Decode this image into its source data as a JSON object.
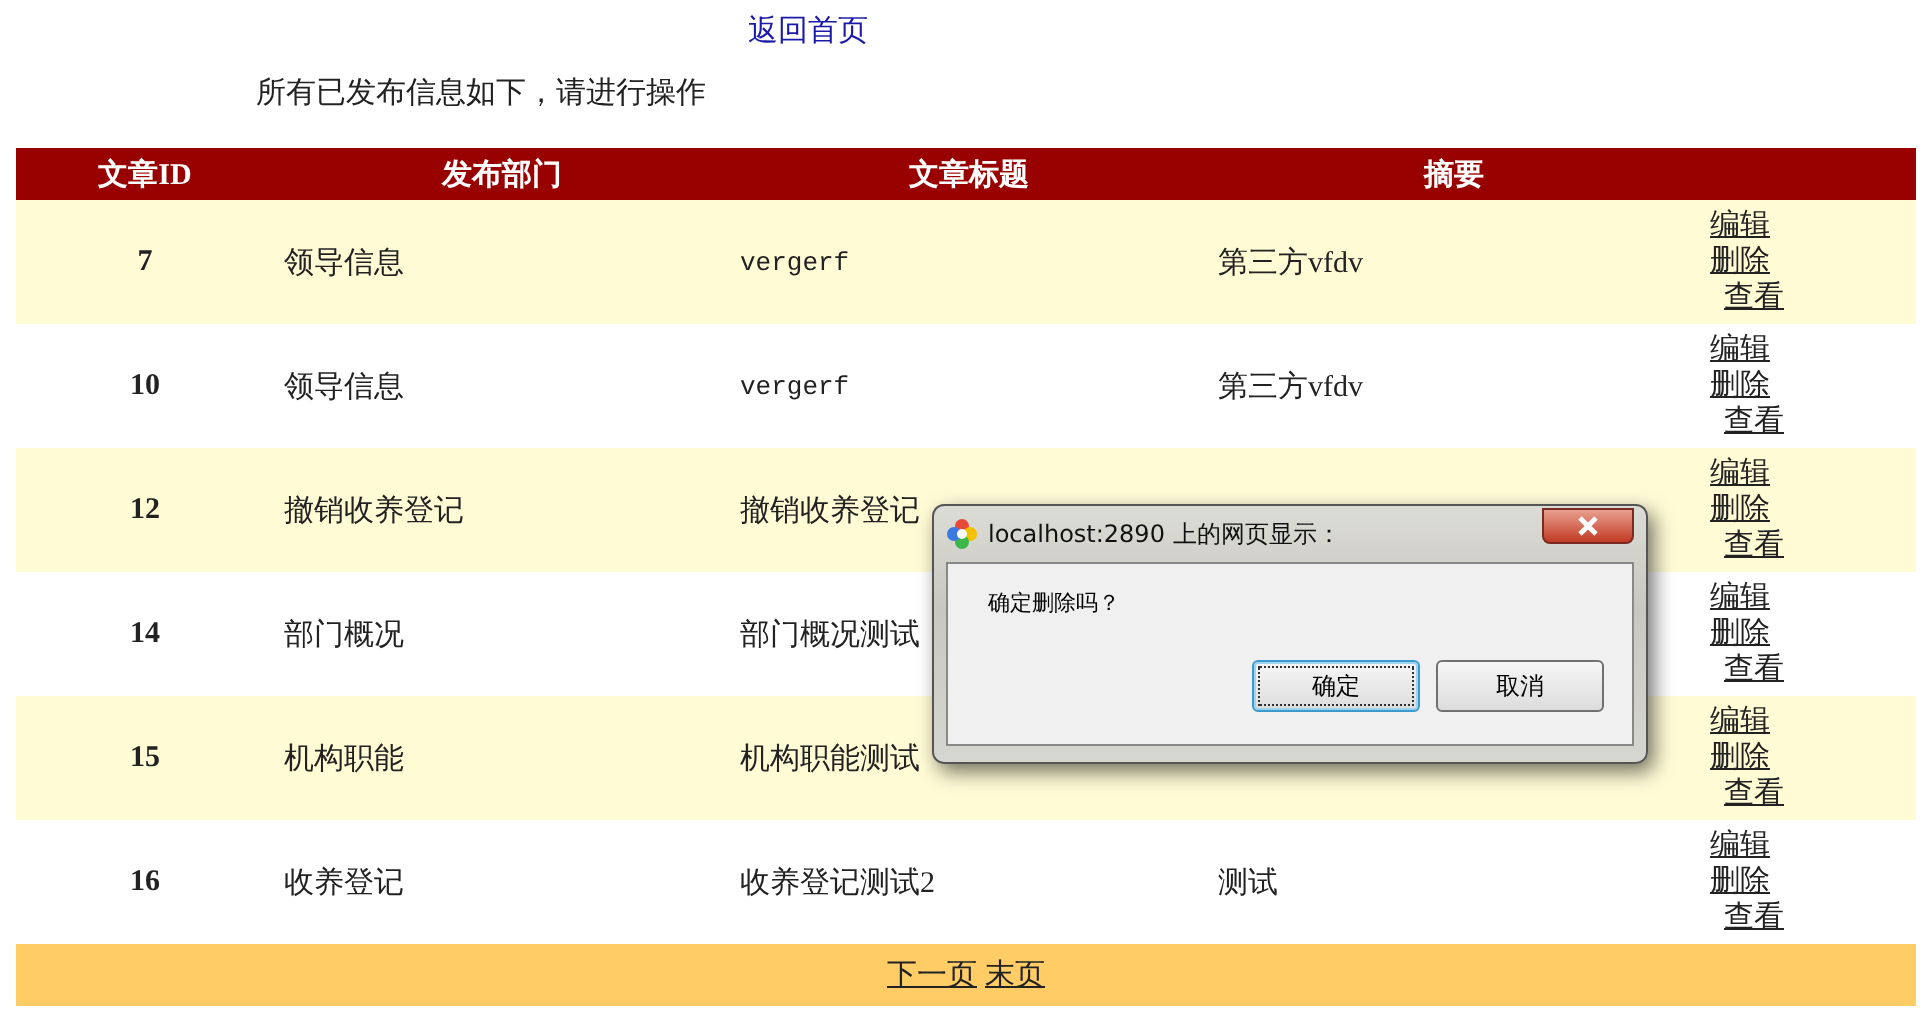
{
  "nav_link": "返回首页",
  "instruction": "所有已发布信息如下，请进行操作",
  "table": {
    "columns": [
      "文章ID",
      "发布部门",
      "文章标题",
      "摘要"
    ],
    "rows": [
      {
        "id": "7",
        "department": "领导信息",
        "title": "vergerf",
        "summary": "第三方vfdv",
        "actions": [
          "编辑",
          "删除",
          "查看"
        ]
      },
      {
        "id": "10",
        "department": "领导信息",
        "title": "vergerf",
        "summary": "第三方vfdv",
        "actions": [
          "编辑",
          "删除",
          "查看"
        ]
      },
      {
        "id": "12",
        "department": "撤销收养登记",
        "title": "撤销收养登记",
        "actions": [
          "编辑",
          "删除",
          "查看"
        ]
      },
      {
        "id": "14",
        "department": "部门概况",
        "title": "部门概况测试",
        "actions": [
          "编辑",
          "删除",
          "查看"
        ]
      },
      {
        "id": "15",
        "department": "机构职能",
        "title": "机构职能测试",
        "actions": [
          "编辑",
          "删除",
          "查看"
        ]
      },
      {
        "id": "16",
        "department": "收养登记",
        "title": "收养登记测试2",
        "summary": "测试",
        "actions": [
          "编辑",
          "删除",
          "查看"
        ]
      }
    ]
  },
  "pager": [
    "下一页",
    "末页"
  ],
  "dialog": {
    "title": "localhost:2890 上的网页显示：",
    "message": "确定删除吗？",
    "buttons": [
      {
        "label": "确定",
        "focused": true
      },
      {
        "label": "取消",
        "focused": false
      }
    ]
  }
}
